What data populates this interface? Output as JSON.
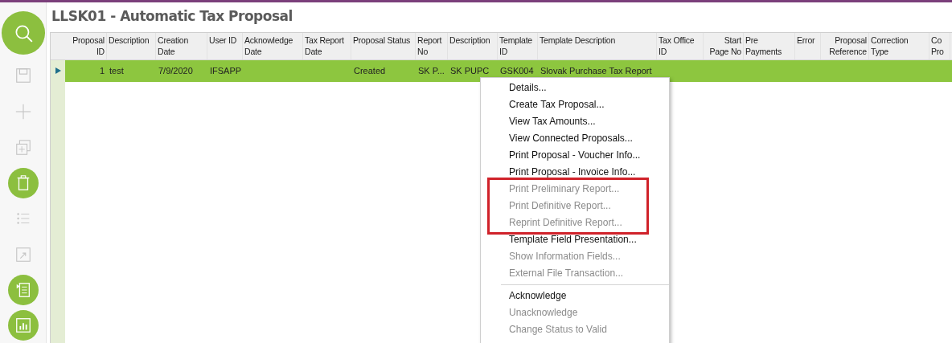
{
  "window": {
    "title": "LLSK01 - Automatic Tax Proposal"
  },
  "sidebar": {
    "buttons": [
      {
        "kind": "round",
        "disabled": false
      },
      {
        "kind": "flat",
        "disabled": true
      },
      {
        "kind": "flat",
        "disabled": true
      },
      {
        "kind": "flat",
        "disabled": true
      },
      {
        "kind": "round",
        "disabled": false
      },
      {
        "kind": "flat",
        "disabled": true
      },
      {
        "kind": "flat",
        "disabled": true
      },
      {
        "kind": "round",
        "disabled": false
      },
      {
        "kind": "round",
        "disabled": false
      }
    ]
  },
  "table": {
    "columns": [
      {
        "label": "Proposal ID",
        "numeric": true
      },
      {
        "label": "Description",
        "numeric": false
      },
      {
        "label": "Creation Date",
        "numeric": false
      },
      {
        "label": "User ID",
        "numeric": false
      },
      {
        "label": "Acknowledge Date",
        "numeric": false
      },
      {
        "label": "Tax Report Date",
        "numeric": false
      },
      {
        "label": "Proposal Status",
        "numeric": false
      },
      {
        "label": "Report No",
        "numeric": false
      },
      {
        "label": "Description",
        "numeric": false
      },
      {
        "label": "Template ID",
        "numeric": false
      },
      {
        "label": "Template Description",
        "numeric": false
      },
      {
        "label": "Tax Office ID",
        "numeric": false
      },
      {
        "label": "Start Page No",
        "numeric": true
      },
      {
        "label": "Pre Payments",
        "numeric": false
      },
      {
        "label": "Error",
        "numeric": false
      },
      {
        "label": "Proposal Reference",
        "numeric": true
      },
      {
        "label": "Correction Type",
        "numeric": false
      },
      {
        "label": "Co Pro",
        "numeric": false
      }
    ],
    "rows": [
      {
        "selected": true,
        "cells": [
          "1",
          "test",
          "7/9/2020",
          "IFSAPP",
          "",
          "",
          "Created",
          "SK P...",
          "SK PUPC",
          "GSK004",
          "Slovak Purchase Tax Report",
          "",
          "",
          "",
          "",
          "",
          "",
          ""
        ]
      }
    ]
  },
  "context_menu": {
    "items": [
      {
        "kind": "item",
        "label": "Details...",
        "disabled": false,
        "highlighted": false
      },
      {
        "kind": "item",
        "label": "Create Tax Proposal...",
        "disabled": false,
        "highlighted": false
      },
      {
        "kind": "item",
        "label": "View Tax Amounts...",
        "disabled": false,
        "highlighted": false
      },
      {
        "kind": "item",
        "label": "View Connected Proposals...",
        "disabled": false,
        "highlighted": false
      },
      {
        "kind": "item",
        "label": "Print Proposal - Voucher Info...",
        "disabled": false,
        "highlighted": false
      },
      {
        "kind": "item",
        "label": "Print Proposal - Invoice Info...",
        "disabled": false,
        "highlighted": false
      },
      {
        "kind": "item",
        "label": "Print Preliminary Report...",
        "disabled": true,
        "highlighted": true
      },
      {
        "kind": "item",
        "label": "Print Definitive Report...",
        "disabled": true,
        "highlighted": true
      },
      {
        "kind": "item",
        "label": "Reprint Definitive Report...",
        "disabled": true,
        "highlighted": true
      },
      {
        "kind": "item",
        "label": "Template Field Presentation...",
        "disabled": false,
        "highlighted": false
      },
      {
        "kind": "item",
        "label": "Show Information Fields...",
        "disabled": true,
        "highlighted": false
      },
      {
        "kind": "item",
        "label": "External File Transaction...",
        "disabled": true,
        "highlighted": false
      },
      {
        "kind": "separator"
      },
      {
        "kind": "item",
        "label": "Acknowledge",
        "disabled": false,
        "highlighted": false
      },
      {
        "kind": "item",
        "label": "Unacknowledge",
        "disabled": true,
        "highlighted": false
      },
      {
        "kind": "item",
        "label": "Change Status to Valid",
        "disabled": true,
        "highlighted": false
      }
    ]
  }
}
